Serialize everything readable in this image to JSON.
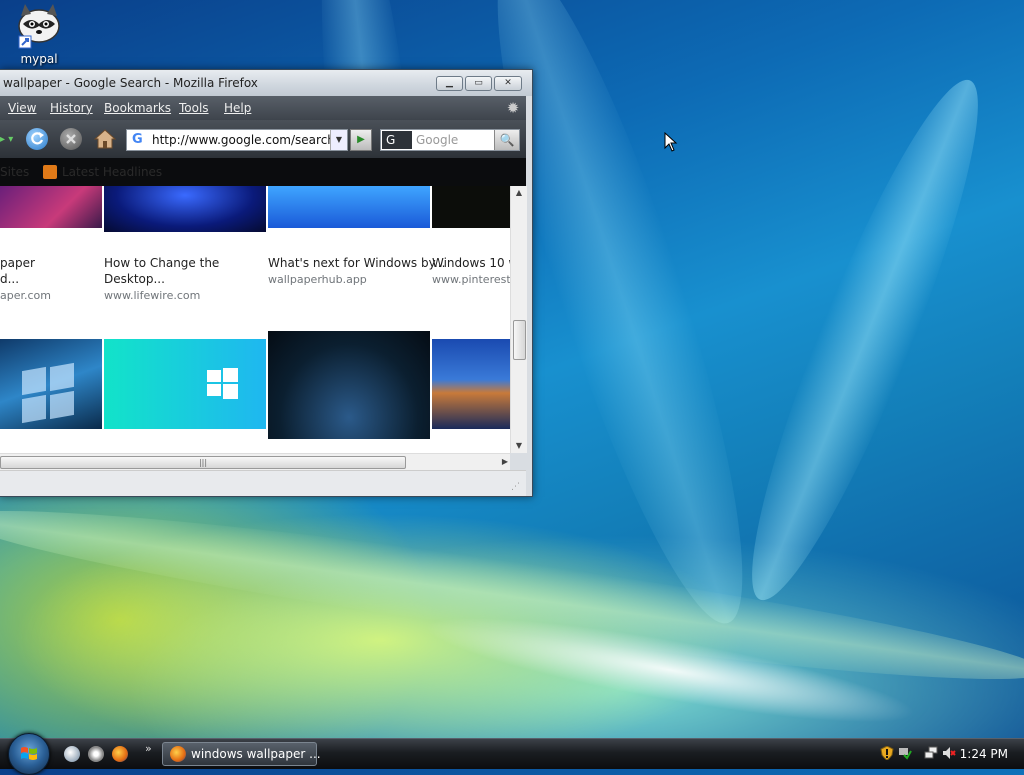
{
  "desktop": {
    "icon_label": "mypal"
  },
  "window": {
    "title": "wallpaper - Google Search - Mozilla Firefox",
    "menu": [
      "View",
      "History",
      "Bookmarks",
      "Tools",
      "Help"
    ],
    "url": "http://www.google.com/search?",
    "search_engine": "G",
    "search_placeholder": "Google",
    "bookmarks": [
      "Sites",
      "Latest Headlines"
    ],
    "results": [
      {
        "title": "paper",
        "title2": "d...",
        "source": "aper.com"
      },
      {
        "title": "How to Change the",
        "title2": "Desktop...",
        "source": "www.lifewire.com"
      },
      {
        "title": "What's next for Windows by...",
        "title2": "",
        "source": "wallpaperhub.app"
      },
      {
        "title": "Windows 10 w",
        "title2": "",
        "source": "www.pinterest"
      }
    ]
  },
  "taskbar": {
    "task_label": "windows wallpaper ...",
    "clock": "1:24 PM",
    "chevron": "»"
  },
  "colors": {
    "accent": "#4285f4",
    "firefox_orange": "#e46b12"
  }
}
